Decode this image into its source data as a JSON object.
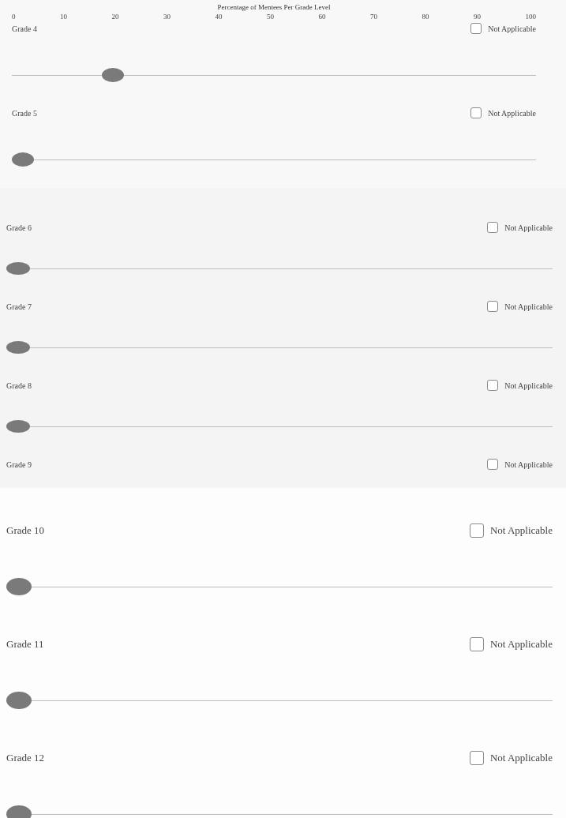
{
  "panels": [
    {
      "scale": {
        "title": "Percentage of Mentees Per Grade Level",
        "ticks": [
          "0",
          "10",
          "20",
          "30",
          "40",
          "50",
          "60",
          "70",
          "80",
          "90",
          "100"
        ]
      },
      "grades": [
        {
          "label": "Grade 4",
          "option": "Not Applicable",
          "checked": false,
          "level": 0.18
        },
        {
          "label": "Grade 5",
          "option": "Not Applicable",
          "checked": false,
          "level": 0
        }
      ]
    },
    {
      "grades": [
        {
          "label": "Grade 6",
          "option": "Not Applicable",
          "checked": false,
          "level": 0
        },
        {
          "label": "Grade 7",
          "option": "Not Applicable",
          "checked": false,
          "level": 0
        },
        {
          "label": "Grade 8",
          "option": "Not Applicable",
          "checked": false,
          "level": 0
        },
        {
          "label": "Grade 9",
          "option": "Not Applicable",
          "checked": false
        }
      ]
    },
    {
      "grades": [
        {
          "label": "Grade 10",
          "option": "Not Applicable",
          "checked": false,
          "level": 0
        },
        {
          "label": "Grade 11",
          "option": "Not Applicable",
          "checked": false,
          "level": 0
        },
        {
          "label": "Grade 12",
          "option": "Not Applicable",
          "checked": false,
          "level": 0
        }
      ]
    }
  ]
}
